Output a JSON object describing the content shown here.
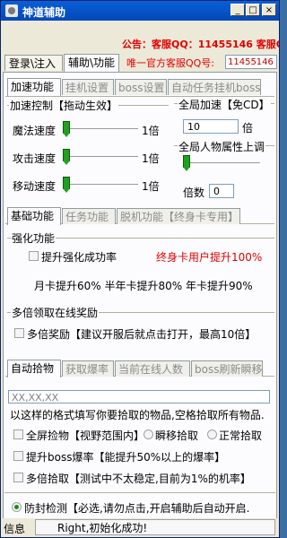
{
  "window": {
    "title": "神道辅助",
    "min": "_",
    "max": "□",
    "close": "×"
  },
  "notice": "公告：客服QQ：11455146 客服QQ",
  "main_tabs": [
    "登录\\注入",
    "辅助\\功能"
  ],
  "official": {
    "label": "唯一官方客服QQ号:",
    "qq": "11455146"
  },
  "top_tabs": [
    "加速功能",
    "挂机设置",
    "boss设置",
    "自动任务挂机boss"
  ],
  "speed": {
    "group": "加速控制【拖动生效】",
    "rows": [
      {
        "label": "魔法速度",
        "value": "1倍",
        "level": 0
      },
      {
        "label": "攻击速度",
        "value": "1倍",
        "level": 0
      },
      {
        "label": "移动速度",
        "value": "1倍",
        "level": 0
      }
    ]
  },
  "global_speed": {
    "group": "全局加速【免CD】",
    "value": "10",
    "unit": "倍"
  },
  "global_attr": {
    "group": "全局人物属性上调",
    "label": "倍数",
    "value": "0",
    "level": 0
  },
  "mid_tabs": [
    "基础功能",
    "任务功能",
    "脱机功能【终身卡专用】"
  ],
  "enhance": {
    "group": "强化功能",
    "checkbox": "提升强化成功率",
    "lifetime": "终身卡用户提升100%",
    "line": "月卡提升60% 半年卡提升80% 年卡提升90%"
  },
  "multi": {
    "group": "多倍领取在线奖励",
    "checkbox": "多倍奖励【建议开服后就点击打开，最高10倍】"
  },
  "bottom_tabs": [
    "自动拾物",
    "获取爆率",
    "当前在线人数",
    "boss刷新瞬移"
  ],
  "pickup": {
    "placeholder": "XX,XX,XX",
    "hint": "以这样的格式填写你要拾取的物品,空格拾取所有物品.",
    "opt_full": "全屏捡物【视野范围内】",
    "opt_instant": "瞬移拾取",
    "opt_normal": "正常拾取",
    "boss_rate": "提升boss爆率【能提升50%以上的爆率】",
    "multi_pick": "多倍拾取【测试中不太稳定,目前为1%的机率】"
  },
  "anti_ban": "防封检测【必选,请勿点击,开启辅助后自动开启.",
  "status": {
    "label": "信息",
    "message": "Right,初始化成功!"
  }
}
